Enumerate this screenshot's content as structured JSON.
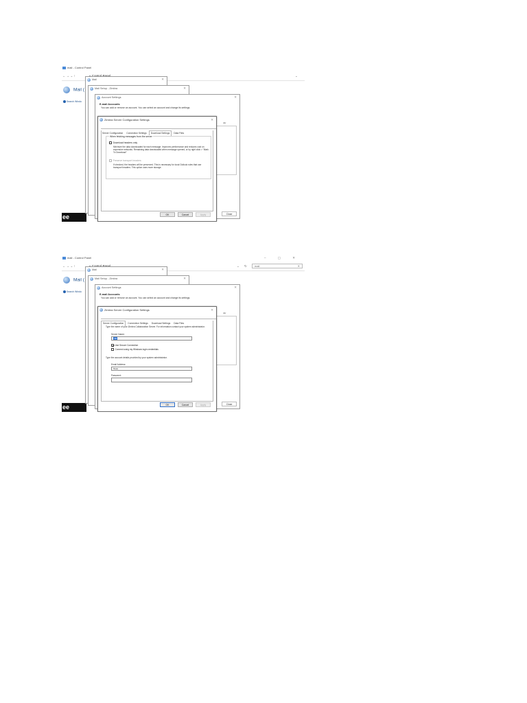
{
  "control_panel": {
    "window_title": "mail - Control Panel",
    "window_controls": "–  ▢  ✕",
    "nav_arrows": "←  →  ⌄  ↑",
    "breadcrumb": "« Control Panel",
    "address_dropdown": "⌄",
    "refresh_icon": "↻",
    "search_value": "mail",
    "search_clear": "✕",
    "heading": "Mail (",
    "search_windows_link": "Search Windo",
    "tools_banner": "ee Tools"
  },
  "windows": {
    "mail_title": "Mail",
    "mail_setup_title": "Mail Setup - Zimbra",
    "close_glyph": "✕"
  },
  "account_settings": {
    "title": "Account Settings",
    "heading": "E-mail Accounts",
    "subtext": "You can add or remove an account. You can select an account and change its settings.",
    "right_label": "nbr",
    "close_button": "Close"
  },
  "zimbra_dialog": {
    "title": "Zimbra Server Configuration Settings",
    "tabs": [
      "Server Configuration",
      "Connection Settings",
      "Download Settings",
      "Data Files"
    ],
    "buttons": {
      "ok": "OK",
      "cancel": "Cancel",
      "apply": "Apply"
    }
  },
  "download_settings": {
    "legend": "When fetching messages from the server",
    "headers_only_label": "Download headers only",
    "headers_only_desc": "Minimize the data downloaded for each message. Improves performance and reduces cost on expensive networks. Remaining data downloaded when message opened, or by right click > \"Mark To Download\"",
    "preserve_label": "Preserve transport headers",
    "preserve_desc": "If checked, the headers will be preserved. This is necessary for local Outlook rules that use transport headers. This option uses more storage."
  },
  "server_configuration": {
    "intro": "Type the name of your Zimbra Collaboration Server. For information contact your system administrator.",
    "server_name_label": "Server Name:",
    "server_name_value": "mb",
    "secure_connection_label": "Use Secure Connection",
    "secure_connection_checked": true,
    "windows_login_label": "Connect using my Windows login credentials",
    "windows_login_checked": false,
    "account_intro": "Type the account details provided by your system administrator.",
    "email_label": "Email Address:",
    "email_value": "ftwas",
    "password_label": "Password:",
    "password_value": ""
  }
}
